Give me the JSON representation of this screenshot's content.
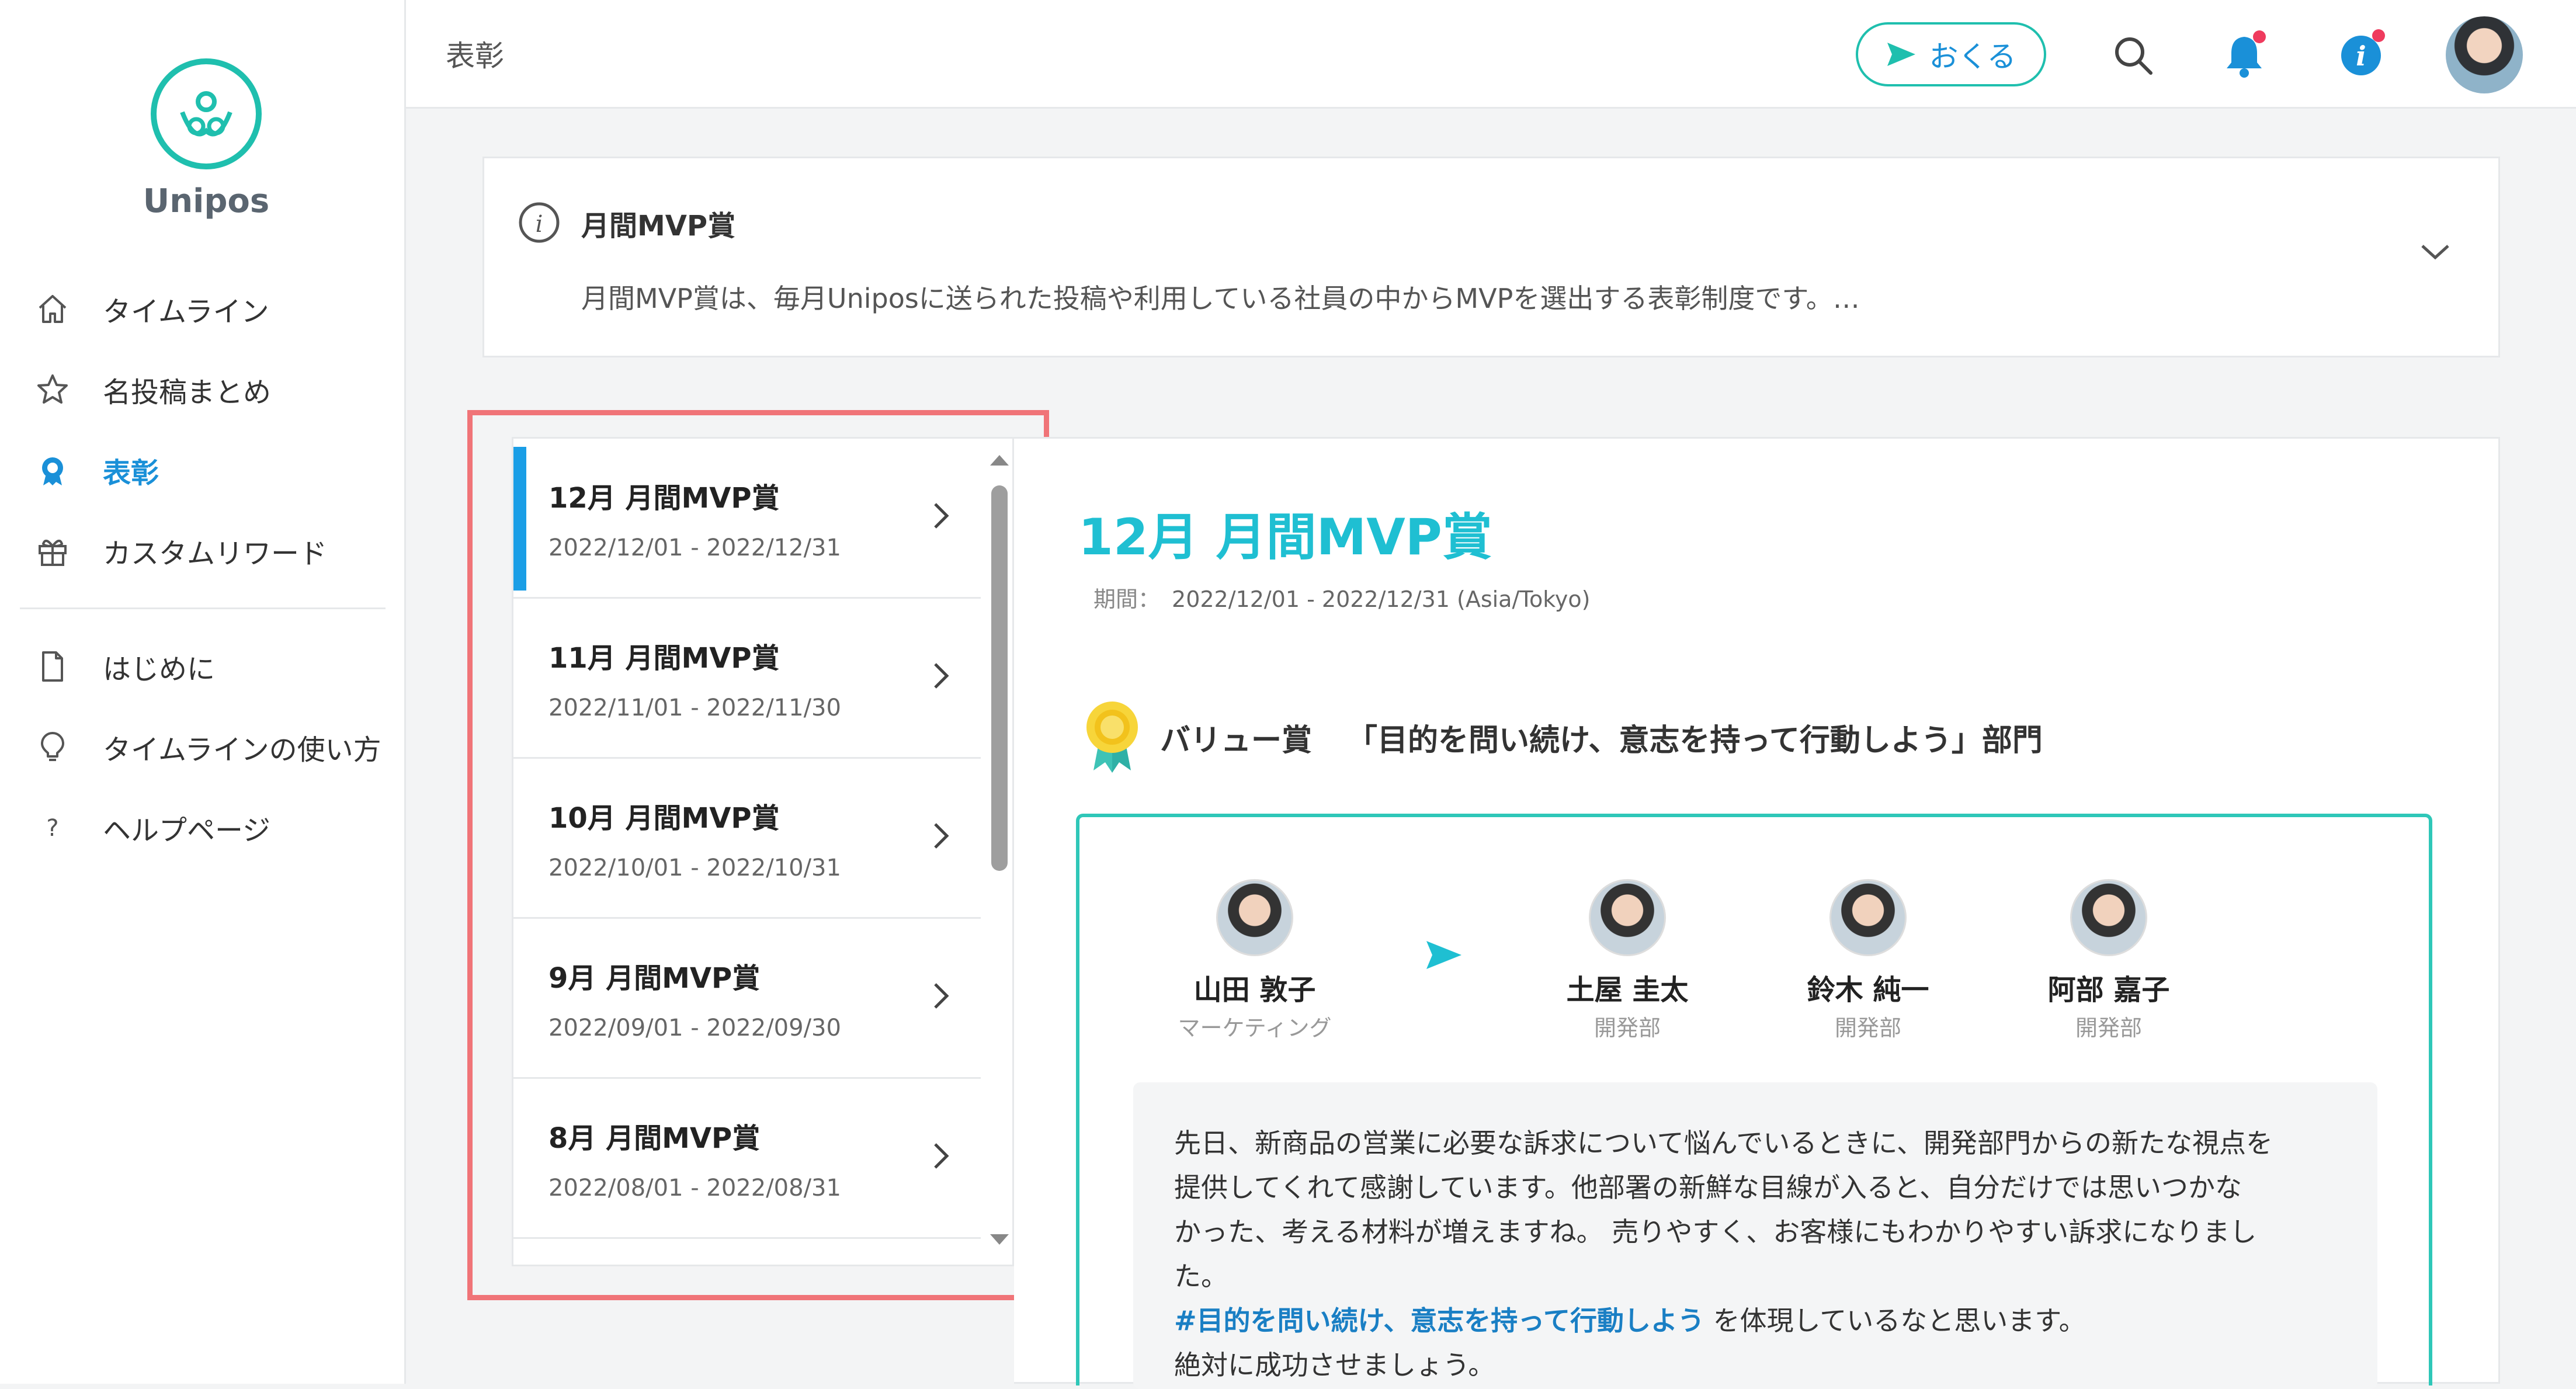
{
  "app": {
    "name": "Unipos"
  },
  "sidebar": {
    "items": [
      {
        "label": "タイムライン",
        "icon": "home-icon"
      },
      {
        "label": "名投稿まとめ",
        "icon": "star-icon"
      },
      {
        "label": "表彰",
        "icon": "award-icon",
        "active": true
      },
      {
        "label": "カスタムリワード",
        "icon": "gift-icon"
      }
    ],
    "secondary": [
      {
        "label": "はじめに",
        "icon": "document-icon"
      },
      {
        "label": "タイムラインの使い方",
        "icon": "lightbulb-icon"
      },
      {
        "label": "ヘルプページ",
        "icon": "question-icon"
      }
    ]
  },
  "header": {
    "title": "表彰",
    "send_label": "おくる",
    "icons": [
      "search-icon",
      "bell-icon",
      "info-icon",
      "avatar"
    ]
  },
  "info": {
    "title": "月間MVP賞",
    "description": "月間MVP賞は、毎月Uniposに送られた投稿や利用している社員の中からMVPを選出する表彰制度です。…"
  },
  "award_list": [
    {
      "title": "12月 月間MVP賞",
      "dates": "2022/12/01 - 2022/12/31",
      "selected": true
    },
    {
      "title": "11月 月間MVP賞",
      "dates": "2022/11/01 - 2022/11/30"
    },
    {
      "title": "10月 月間MVP賞",
      "dates": "2022/10/01 - 2022/10/31"
    },
    {
      "title": "9月 月間MVP賞",
      "dates": "2022/09/01 - 2022/09/30"
    },
    {
      "title": "8月 月間MVP賞",
      "dates": "2022/08/01 - 2022/08/31"
    }
  ],
  "detail": {
    "title": "12月 月間MVP賞",
    "period_label": "期間：",
    "period": "2022/12/01 - 2022/12/31 (Asia/Tokyo)",
    "award_name": "バリュー賞",
    "award_dept": "「目的を問い続け、意志を持って行動しよう」部門",
    "sender": {
      "name": "山田 敦子",
      "dept": "マーケティング"
    },
    "recipients": [
      {
        "name": "土屋 圭太",
        "dept": "開発部"
      },
      {
        "name": "鈴木 純一",
        "dept": "開発部"
      },
      {
        "name": "阿部 嘉子",
        "dept": "開発部"
      }
    ],
    "message": {
      "line1": "先日、新商品の営業に必要な訴求について悩んでいるときに、開発部門からの新たな視点を",
      "line2": "提供してくれて感謝しています。他部署の新鮮な目線が入ると、自分だけでは思いつかな",
      "line3": "かった、考える材料が増えますね。 売りやすく、お客様にもわかりやすい訴求になりまし",
      "line4": "た。",
      "hashtag": "#目的を問い続け、意志を持って行動しよう",
      "line5_suffix": " を体現しているなと思います。",
      "line6": "絶対に成功させましょう。"
    }
  },
  "colors": {
    "accent": "#1fbfae",
    "link": "#1a90d8",
    "highlight": "#f07478",
    "badge": "#ef3b5e"
  }
}
